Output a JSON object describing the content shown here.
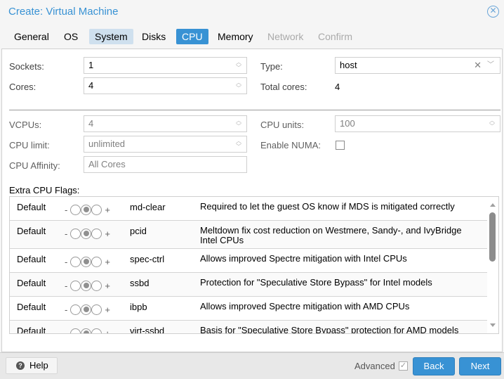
{
  "window": {
    "title": "Create: Virtual Machine",
    "close_icon": "circle-x"
  },
  "tabs": [
    {
      "label": "General",
      "state": "normal"
    },
    {
      "label": "OS",
      "state": "normal"
    },
    {
      "label": "System",
      "state": "visited"
    },
    {
      "label": "Disks",
      "state": "normal"
    },
    {
      "label": "CPU",
      "state": "active"
    },
    {
      "label": "Memory",
      "state": "normal"
    },
    {
      "label": "Network",
      "state": "disabled"
    },
    {
      "label": "Confirm",
      "state": "disabled"
    }
  ],
  "form": {
    "sockets": {
      "label": "Sockets:",
      "value": "1"
    },
    "cores": {
      "label": "Cores:",
      "value": "4"
    },
    "type": {
      "label": "Type:",
      "value": "host"
    },
    "total_cores": {
      "label": "Total cores:",
      "value": "4"
    },
    "vcpus": {
      "label": "VCPUs:",
      "value": "4"
    },
    "cpu_units": {
      "label": "CPU units:",
      "value": "100"
    },
    "cpu_limit": {
      "label": "CPU limit:",
      "value": "unlimited"
    },
    "enable_numa": {
      "label": "Enable NUMA:",
      "checked": false
    },
    "cpu_affinity": {
      "label": "CPU Affinity:",
      "placeholder": "All Cores"
    }
  },
  "flags": {
    "label": "Extra CPU Flags:",
    "rows": [
      {
        "state": "Default",
        "minus": "-",
        "plus": "+",
        "flag": "md-clear",
        "description": "Required to let the guest OS know if MDS is mitigated correctly"
      },
      {
        "state": "Default",
        "minus": "-",
        "plus": "+",
        "flag": "pcid",
        "description": "Meltdown fix cost reduction on Westmere, Sandy-, and IvyBridge Intel CPUs"
      },
      {
        "state": "Default",
        "minus": "-",
        "plus": "+",
        "flag": "spec-ctrl",
        "description": "Allows improved Spectre mitigation with Intel CPUs"
      },
      {
        "state": "Default",
        "minus": "-",
        "plus": "+",
        "flag": "ssbd",
        "description": "Protection for \"Speculative Store Bypass\" for Intel models"
      },
      {
        "state": "Default",
        "minus": "-",
        "plus": "+",
        "flag": "ibpb",
        "description": "Allows improved Spectre mitigation with AMD CPUs"
      },
      {
        "state": "Default",
        "minus": "-",
        "plus": "+",
        "flag": "virt-ssbd",
        "description": "Basis for \"Speculative Store Bypass\" protection for AMD models"
      }
    ]
  },
  "footer": {
    "help_label": "Help",
    "help_icon": "?",
    "advanced_label": "Advanced",
    "advanced_checked": true,
    "back_label": "Back",
    "next_label": "Next"
  },
  "colors": {
    "accent": "#3892d4",
    "tab_visited": "#cfe0ee",
    "disabled_text": "#aaaaaa"
  }
}
